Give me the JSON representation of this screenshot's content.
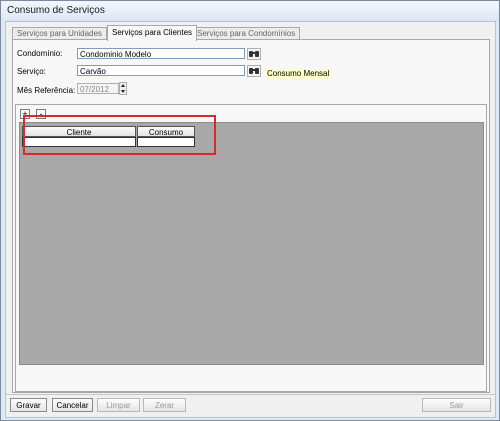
{
  "window": {
    "title": "Consumo de Serviços"
  },
  "tabs": [
    {
      "label": "Serviços para Unidades"
    },
    {
      "label": "Serviços para Clientes"
    },
    {
      "label": "Serviços para Condomínios"
    }
  ],
  "form": {
    "condominio_label": "Condomínio:",
    "condominio_value": "Condominio Modelo",
    "servico_label": "Serviço:",
    "servico_value": "Carvão",
    "consumo_hint": "Consumo Mensal",
    "mes_label": "Mês Referência:",
    "mes_value": "07/2012"
  },
  "grid": {
    "add_label": "+",
    "remove_label": "-",
    "columns": [
      "Cliente",
      "Consumo"
    ]
  },
  "buttons": {
    "gravar": "Gravar",
    "cancelar": "Cancelar",
    "limpar": "Limpar",
    "zerar": "Zerar",
    "sair": "Sair"
  },
  "icons": {
    "lookup_condominio": "binoculars-icon",
    "lookup_servico": "binoculars-icon",
    "spin_up": "arrow-up-icon",
    "spin_down": "arrow-down-icon"
  },
  "colors": {
    "highlight": "#d42b2b",
    "hint_bg": "#ffffcc",
    "grid_bg": "#a8a8a8"
  }
}
